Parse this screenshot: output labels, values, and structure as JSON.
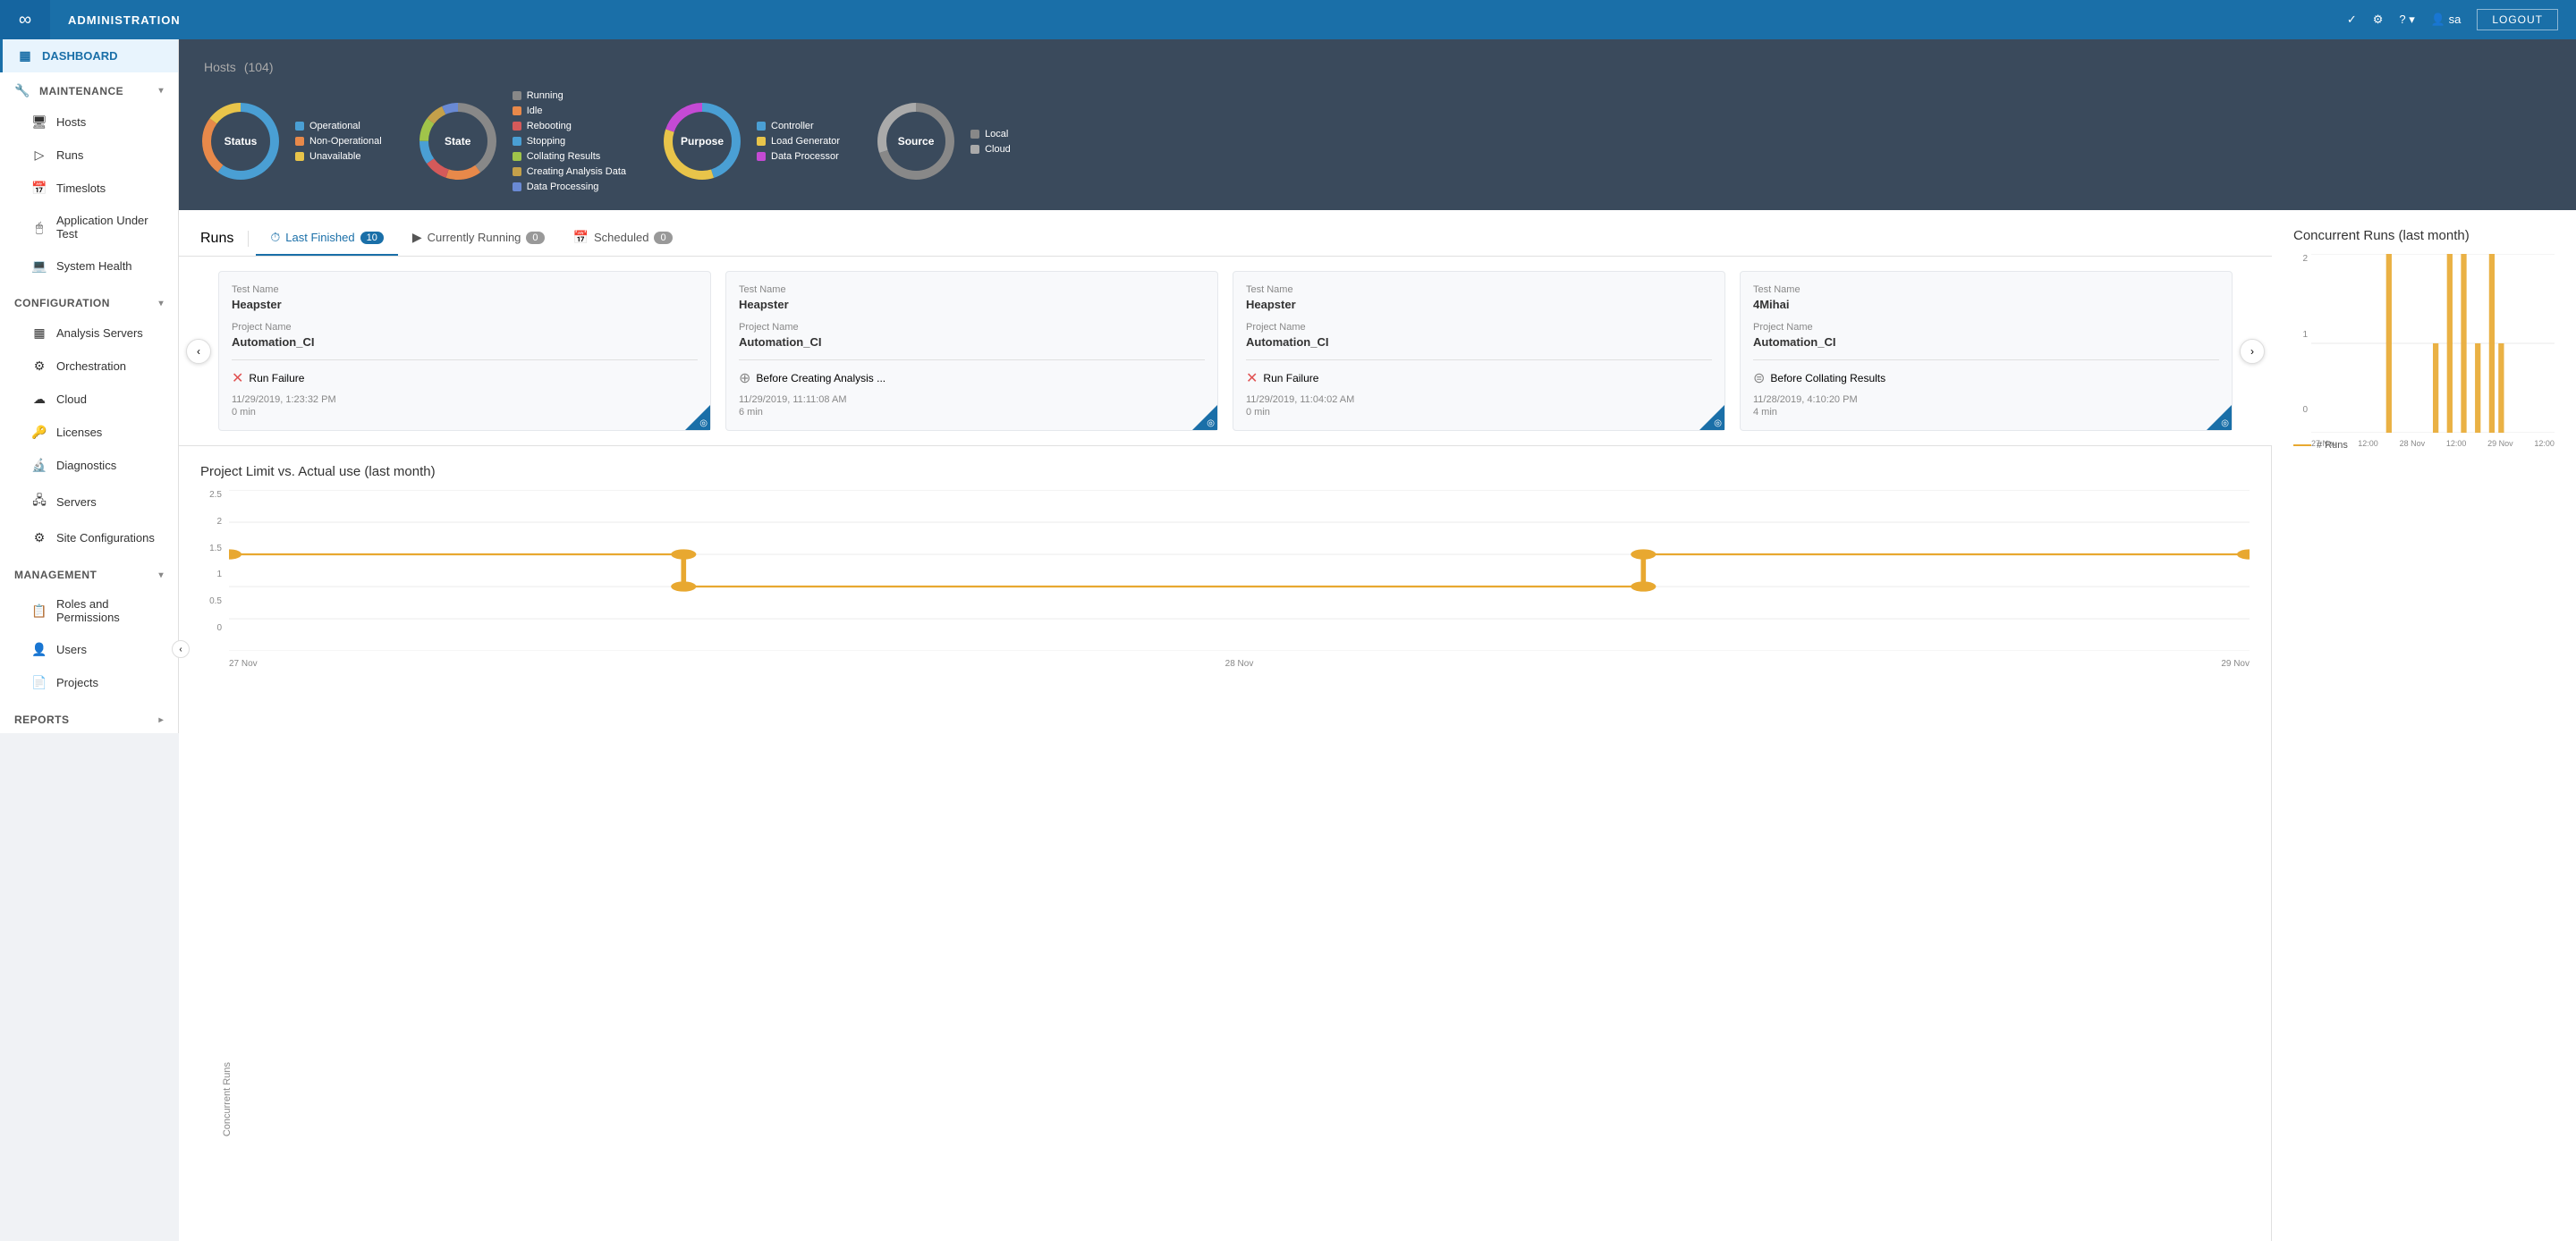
{
  "topNav": {
    "logo": "∞",
    "title": "ADMINISTRATION",
    "icons": [
      "✓",
      "⚙",
      "?",
      "sa"
    ],
    "logout": "LOGOUT"
  },
  "sidebar": {
    "items": [
      {
        "id": "dashboard",
        "label": "DASHBOARD",
        "icon": "▦",
        "type": "top",
        "active": true
      },
      {
        "id": "maintenance",
        "label": "MAINTENANCE",
        "icon": "🔧",
        "type": "section",
        "expanded": true
      },
      {
        "id": "hosts",
        "label": "Hosts",
        "icon": "🖥",
        "type": "child"
      },
      {
        "id": "runs",
        "label": "Runs",
        "icon": "▶",
        "type": "child"
      },
      {
        "id": "timeslots",
        "label": "Timeslots",
        "icon": "📅",
        "type": "child"
      },
      {
        "id": "aut",
        "label": "Application Under Test",
        "icon": "🖱",
        "type": "child"
      },
      {
        "id": "systemhealth",
        "label": "System Health",
        "icon": "💻",
        "type": "child"
      },
      {
        "id": "configuration",
        "label": "CONFIGURATION",
        "icon": "",
        "type": "section",
        "expanded": true
      },
      {
        "id": "analysis-servers",
        "label": "Analysis Servers",
        "icon": "▦",
        "type": "child"
      },
      {
        "id": "orchestration",
        "label": "Orchestration",
        "icon": "⚙",
        "type": "child"
      },
      {
        "id": "cloud",
        "label": "Cloud",
        "icon": "☁",
        "type": "child"
      },
      {
        "id": "licenses",
        "label": "Licenses",
        "icon": "🔑",
        "type": "child"
      },
      {
        "id": "diagnostics",
        "label": "Diagnostics",
        "icon": "🔬",
        "type": "child"
      },
      {
        "id": "servers",
        "label": "Servers",
        "icon": "🖧",
        "type": "child"
      },
      {
        "id": "site-configurations",
        "label": "Site Configurations",
        "icon": "⚙",
        "type": "child"
      },
      {
        "id": "management",
        "label": "MANAGEMENT",
        "icon": "",
        "type": "section",
        "expanded": true
      },
      {
        "id": "roles-permissions",
        "label": "Roles and Permissions",
        "icon": "📋",
        "type": "child"
      },
      {
        "id": "users",
        "label": "Users",
        "icon": "👤",
        "type": "child"
      },
      {
        "id": "projects",
        "label": "Projects",
        "icon": "📄",
        "type": "child"
      },
      {
        "id": "reports",
        "label": "REPORTS",
        "icon": "",
        "type": "section",
        "hasArrow": true
      }
    ],
    "collapseLabel": "<"
  },
  "hosts": {
    "title": "Hosts",
    "count": "(104)",
    "charts": [
      {
        "id": "status",
        "label": "Status",
        "segments": [
          {
            "color": "#4a9fd4",
            "value": 60,
            "label": "Operational"
          },
          {
            "color": "#e8894a",
            "value": 25,
            "label": "Non-Operational"
          },
          {
            "color": "#e8c44a",
            "value": 15,
            "label": "Unavailable"
          }
        ]
      },
      {
        "id": "state",
        "label": "State",
        "segments": [
          {
            "color": "#888",
            "value": 40,
            "label": "Running"
          },
          {
            "color": "#e8894a",
            "value": 15,
            "label": "Idle"
          },
          {
            "color": "#d45a5a",
            "value": 10,
            "label": "Rebooting"
          },
          {
            "color": "#4a9fd4",
            "value": 10,
            "label": "Stopping"
          },
          {
            "color": "#a0c44a",
            "value": 10,
            "label": "Collating Results"
          },
          {
            "color": "#c4a04a",
            "value": 8,
            "label": "Creating Analysis Data"
          },
          {
            "color": "#6a8ad4",
            "value": 7,
            "label": "Data Processing"
          }
        ]
      },
      {
        "id": "purpose",
        "label": "Purpose",
        "segments": [
          {
            "color": "#4a9fd4",
            "value": 45,
            "label": "Controller"
          },
          {
            "color": "#e8c44a",
            "value": 35,
            "label": "Load Generator"
          },
          {
            "color": "#c44ad4",
            "value": 20,
            "label": "Data Processor"
          }
        ]
      },
      {
        "id": "source",
        "label": "Source",
        "segments": [
          {
            "color": "#888",
            "value": 70,
            "label": "Local"
          },
          {
            "color": "#aaa",
            "value": 30,
            "label": "Cloud"
          }
        ]
      }
    ]
  },
  "runs": {
    "title": "Runs",
    "tabs": [
      {
        "id": "last-finished",
        "icon": "⏱",
        "label": "Last Finished",
        "count": "10"
      },
      {
        "id": "currently-running",
        "icon": "▶",
        "label": "Currently Running",
        "count": "0"
      },
      {
        "id": "scheduled",
        "icon": "📅",
        "label": "Scheduled",
        "count": "0"
      }
    ],
    "cards": [
      {
        "testNameLabel": "Test Name",
        "testName": "Heapster",
        "projectNameLabel": "Project Name",
        "projectName": "Automation_CI",
        "statusIcon": "fail",
        "statusText": "Run Failure",
        "time": "11/29/2019, 1:23:32 PM",
        "duration": "0 min",
        "cornerIcon": "🔍"
      },
      {
        "testNameLabel": "Test Name",
        "testName": "Heapster",
        "projectNameLabel": "Project Name",
        "projectName": "Automation_CI",
        "statusIcon": "pending",
        "statusText": "Before Creating Analysis ...",
        "time": "11/29/2019, 11:11:08 AM",
        "duration": "6 min",
        "cornerIcon": "🔍"
      },
      {
        "testNameLabel": "Test Name",
        "testName": "Heapster",
        "projectNameLabel": "Project Name",
        "projectName": "Automation_CI",
        "statusIcon": "fail",
        "statusText": "Run Failure",
        "time": "11/29/2019, 11:04:02 AM",
        "duration": "0 min",
        "cornerIcon": "🔍"
      },
      {
        "testNameLabel": "Test Name",
        "testName": "4Mihai",
        "projectNameLabel": "Project Name",
        "projectName": "Automation_CI",
        "statusIcon": "collating",
        "statusText": "Before Collating Results",
        "time": "11/28/2019, 4:10:20 PM",
        "duration": "4 min",
        "cornerIcon": "🔍"
      }
    ]
  },
  "concurrentRuns": {
    "title": "Concurrent Runs (last month)",
    "legend": "# Runs",
    "yLabels": [
      "0",
      "1",
      "2"
    ],
    "xLabels": [
      "27 Nov",
      "12:00",
      "28 Nov",
      "12:00",
      "29 Nov",
      "12:00"
    ]
  },
  "projectLimit": {
    "title": "Project Limit vs. Actual use (last month)",
    "yAxisLabel": "Concurrent Runs",
    "yLabels": [
      "0.5",
      "1",
      "1.5",
      "2",
      "2.5"
    ]
  }
}
